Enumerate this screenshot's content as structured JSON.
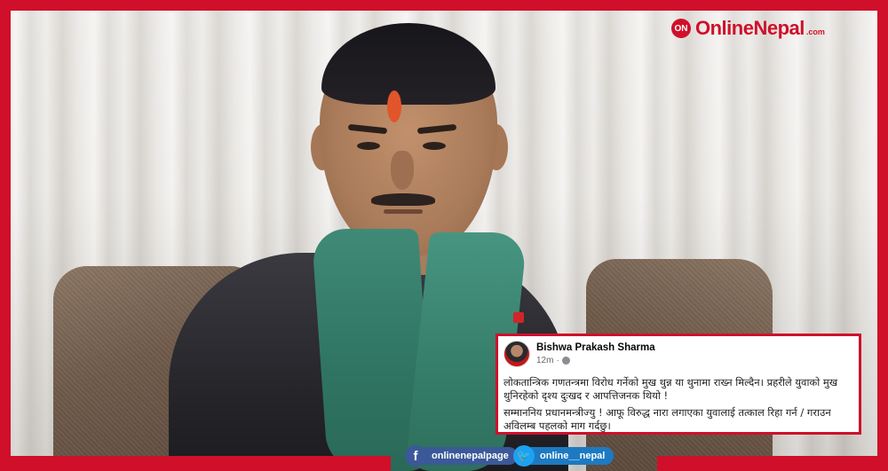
{
  "brand": {
    "logo_mark": "ON",
    "logo_word": "OnlineNepal",
    "logo_tld": ".com",
    "accent_color": "#d0102a"
  },
  "post": {
    "author": "Bishwa Prakash Sharma",
    "time": "12m",
    "audience_icon": "globe-icon",
    "paragraph_1": "लोकतान्त्रिक गणतन्त्रमा विरोध गर्नेको मुख थुन्न या थुनामा राख्न मिल्दैन। प्रहरीले युवाको मुख थुनिरहेको दृश्य दुःखद र आपत्तिजनक थियो !",
    "paragraph_2": "सम्माननिय प्रधानमन्त्रीज्यु ! आफू विरुद्ध नारा लगाएका युवालाई तत्काल रिहा गर्न / गराउन अविलम्ब पहलको माग गर्दछु।"
  },
  "social": {
    "facebook_handle": "onlinenepalpage",
    "facebook_icon": "f",
    "twitter_handle": "online__nepal",
    "twitter_icon": "🐦"
  }
}
